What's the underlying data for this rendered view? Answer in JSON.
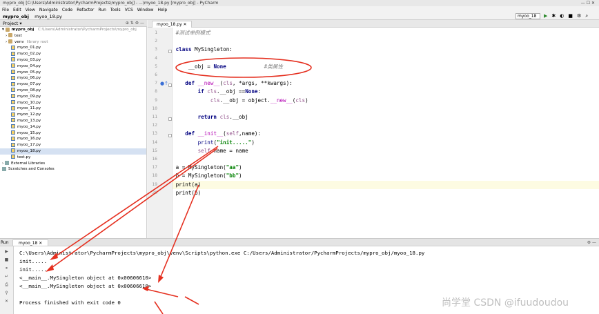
{
  "window": {
    "title": "mypro_obj [C:\\Users\\Administrator\\PycharmProjects\\mypro_obj] - ...\\myoo_18.py [mypro_obj] - PyCharm",
    "controls": "— ☐ ✕"
  },
  "menu": [
    "File",
    "Edit",
    "View",
    "Navigate",
    "Code",
    "Refactor",
    "Run",
    "Tools",
    "VCS",
    "Window",
    "Help"
  ],
  "breadcrumb": {
    "project": "mypro_obj",
    "file": "myoo_18.py"
  },
  "run_config": "myoo_18",
  "project_panel": {
    "title": "Project",
    "root_name": "mypro_obj",
    "root_path": "C:\\Users\\Administrator\\PycharmProjects\\mypro_obj",
    "folders": [
      "test",
      "venv"
    ],
    "venv_hint": "library root",
    "files": [
      "myoo_01.py",
      "myoo_02.py",
      "myoo_03.py",
      "myoo_04.py",
      "myoo_05.py",
      "myoo_06.py",
      "myoo_07.py",
      "myoo_08.py",
      "myoo_09.py",
      "myoo_10.py",
      "myoo_11.py",
      "myoo_12.py",
      "myoo_13.py",
      "myoo_14.py",
      "myoo_15.py",
      "myoo_16.py",
      "myoo_17.py",
      "myoo_18.py",
      "test.py"
    ],
    "selected_file": "myoo_18.py",
    "extra": [
      "External Libraries",
      "Scratches and Consoles"
    ]
  },
  "editor": {
    "tab": "myoo_18.py",
    "line_numbers": [
      "1",
      "2",
      "3",
      "4",
      "5",
      "6",
      "7",
      "8",
      "9",
      "10",
      "11",
      "12",
      "13",
      "14",
      "15",
      "16",
      "17",
      "18",
      "19",
      "20"
    ],
    "code": {
      "l1": "#测试单例模式",
      "l3_kw": "class",
      "l3_rest": " MySingleton:",
      "l5_a": "    __obj = ",
      "l5_kw": "None",
      "l5_cm": "#类属性",
      "l7_kw": "def",
      "l7_mg": "__new__",
      "l7_a": "(",
      "l7_sf": "cls",
      "l7_b": ", *args, **kwargs):",
      "l8_kw": "if",
      "l8_sf": "cls",
      "l8_a": ".__obj ==",
      "l8_kw2": "None",
      "l9_sf": "cls",
      "l9_a": ".__obj = object.",
      "l9_mg": "__new__",
      "l9_b": "(",
      "l9_sf2": "cls",
      "l9_c": ")",
      "l11_kw": "return",
      "l11_sf": "cls",
      "l11_a": ".__obj",
      "l13_kw": "def",
      "l13_mg": "__init__",
      "l13_a": "(",
      "l13_sf": "self",
      "l13_b": ",name):",
      "l14_bi": "print",
      "l14_a": "(",
      "l14_st": "\"init.....\"",
      "l14_b": ")",
      "l15_sf": "self",
      "l15_a": ".name = name",
      "l17_a": "a = MySingleton(",
      "l17_st": "\"aa\"",
      "l17_b": ")",
      "l18_a": "b = MySingleton(",
      "l18_st": "\"bb\"",
      "l18_b": ")",
      "l19": "print(a)",
      "l20": "print(b)"
    }
  },
  "run_panel": {
    "label": "Run",
    "tab": "myoo_18",
    "output": [
      "C:\\Users\\Administrator\\PycharmProjects\\mypro_obj\\venv\\Scripts\\python.exe C:/Users/Administrator/PycharmProjects/mypro_obj/myoo_18.py",
      "init.....",
      "init.....",
      "<__main__.MySingleton object at 0x00606610>",
      "<__main__.MySingleton object at 0x00606610>",
      "",
      "Process finished with exit code 0"
    ]
  },
  "watermark": "尚学堂 CSDN @ifuudoudou",
  "colors": {
    "annotation": "#e53020",
    "selection": "#d5e1f2",
    "highlight_line": "#fdfbe2"
  }
}
